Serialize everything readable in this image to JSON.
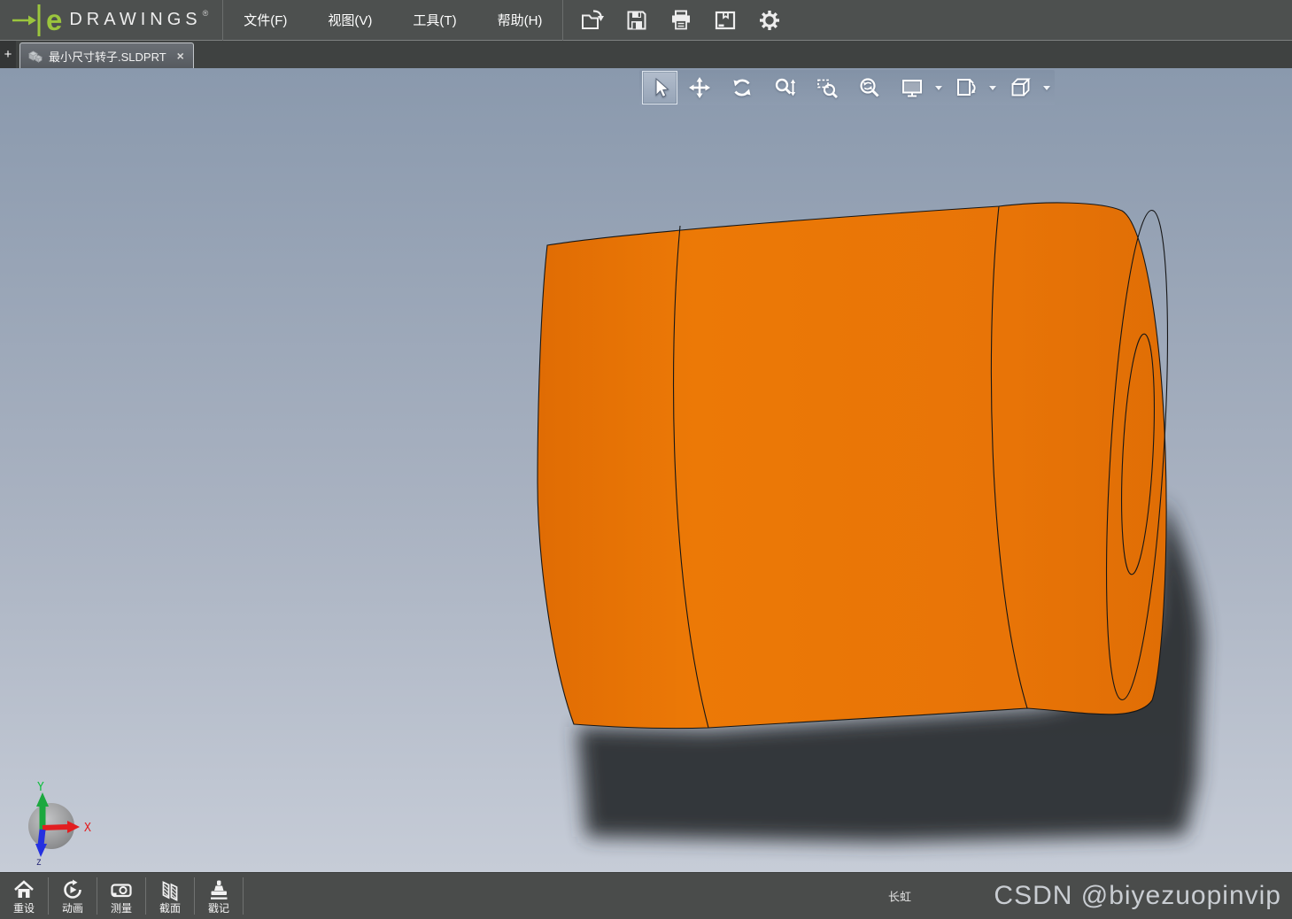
{
  "brand": {
    "e": "e",
    "name": "DRAWINGS",
    "reg": "®"
  },
  "menu": {
    "items": [
      {
        "label": "文件(F)"
      },
      {
        "label": "视图(V)"
      },
      {
        "label": "工具(T)"
      },
      {
        "label": "帮助(H)"
      }
    ]
  },
  "quickbar": {
    "icons": [
      "open",
      "save",
      "print",
      "publish",
      "settings"
    ]
  },
  "tabs": {
    "add_label": "+",
    "active": {
      "title": "最小尺寸转子.SLDPRT",
      "close_label": "×"
    }
  },
  "view_toolbar": {
    "active": "select",
    "icons": [
      "select",
      "pan",
      "rotate",
      "zoom",
      "zoom-to-area",
      "zoom-to-fit",
      "full-screen",
      "markup-views",
      "orientation-cube"
    ]
  },
  "bottom_toolbar": {
    "buttons": [
      {
        "label": "重设",
        "icon": "home"
      },
      {
        "label": "动画",
        "icon": "animation"
      },
      {
        "label": "测量",
        "icon": "measure"
      },
      {
        "label": "截面",
        "icon": "section"
      },
      {
        "label": "戳记",
        "icon": "stamp"
      }
    ]
  },
  "status": {
    "owner": "长虹",
    "watermark": "CSDN @biyezuopinvip"
  },
  "axis": {
    "x": "X",
    "y": "Y",
    "z": "Z"
  },
  "colors": {
    "model_orange": "#E87507",
    "canvas_top": "#8A99AD",
    "canvas_bottom": "#C6CCD7",
    "bar_dark": "#4D504F",
    "accent_green": "#9BC53D",
    "shadow": "#2D3136"
  }
}
